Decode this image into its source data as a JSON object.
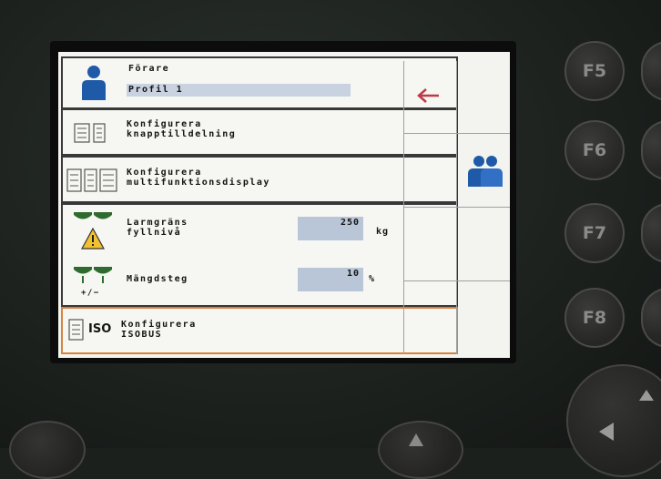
{
  "screen": {
    "driver": {
      "title": "Förare",
      "profile": "Profil 1"
    },
    "menu_items": [
      {
        "line1": "Konfigurera",
        "line2": "knapptilldelning"
      },
      {
        "line1": "Konfigurera",
        "line2": "multifunktionsdisplay"
      }
    ],
    "alarm_limit": {
      "line1": "Larmgräns",
      "line2": "fyllnivå",
      "value": "250",
      "unit": "kg"
    },
    "quantity_step": {
      "label": "Mängdsteg",
      "value": "10",
      "unit": "%",
      "icon_text": "+/−"
    },
    "isobus": {
      "icon_text": "ISO",
      "line1": "Konfigurera",
      "line2": "ISOBUS"
    }
  },
  "function_keys": [
    "F5",
    "F6",
    "F7",
    "F8"
  ],
  "colors": {
    "accent_selected": "#d9823e",
    "back_arrow": "#c0394a",
    "value_box": "#b9c6d8",
    "icon_blue": "#1e5aa8"
  }
}
